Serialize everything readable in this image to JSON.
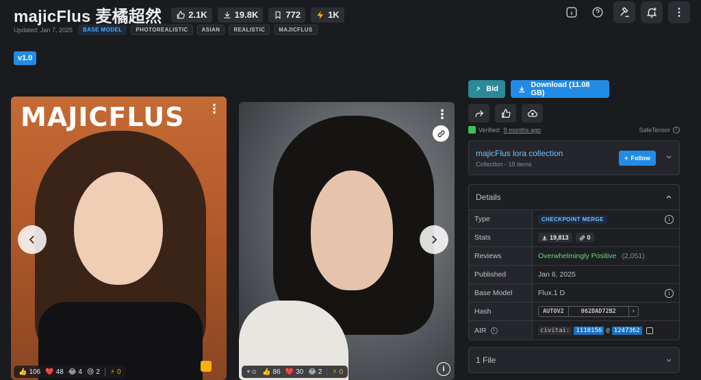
{
  "header": {
    "title": "majicFlus 麦橘超然",
    "stats": [
      {
        "icon": "thumbs-up-icon",
        "value": "2.1K"
      },
      {
        "icon": "download-icon",
        "value": "19.8K"
      },
      {
        "icon": "bookmark-icon",
        "value": "772"
      },
      {
        "icon": "lightning-icon",
        "value": "1K"
      }
    ],
    "updated": "Updated: Jan 7, 2025",
    "tags": [
      "BASE MODEL",
      "PHOTOREALISTIC",
      "ASIAN",
      "REALISTIC",
      "MAJICFLUS"
    ]
  },
  "version": "v1.0",
  "gallery": {
    "card1": {
      "overlay_title": "MAJICFLUS",
      "reactions": [
        {
          "icon": "thumbs-up-emoji",
          "glyph": "👍",
          "count": "106"
        },
        {
          "icon": "heart-emoji",
          "glyph": "❤️",
          "count": "48"
        },
        {
          "icon": "laugh-emoji",
          "glyph": "😂",
          "count": "4"
        },
        {
          "icon": "cry-emoji",
          "glyph": "😢",
          "count": "2"
        },
        {
          "icon": "lightning-emoji",
          "glyph": "⚡",
          "count": "0"
        }
      ]
    },
    "card2": {
      "reactions": [
        {
          "icon": "thumbs-up-emoji",
          "glyph": "👍",
          "count": "86"
        },
        {
          "icon": "heart-emoji",
          "glyph": "❤️",
          "count": "30"
        },
        {
          "icon": "laugh-emoji",
          "glyph": "😂",
          "count": "2"
        },
        {
          "icon": "lightning-emoji",
          "glyph": "⚡",
          "count": "0"
        }
      ]
    }
  },
  "actions": {
    "bid_label": "Bid",
    "download_label": "Download (11.08 GB)"
  },
  "verified": {
    "prefix": "Verified:",
    "when": "9 months ago",
    "format": "SafeTensor"
  },
  "collection": {
    "name": "majicFlus lora collection",
    "subtitle": "Collection - 19 items",
    "follow_label": "Follow"
  },
  "details": {
    "heading": "Details",
    "type_label": "Type",
    "type_value": "CHECKPOINT MERGE",
    "stats_label": "Stats",
    "stats_downloads": "19,813",
    "stats_links": "0",
    "reviews_label": "Reviews",
    "reviews_value": "Overwhelmingly Positive",
    "reviews_count": "(2,051)",
    "published_label": "Published",
    "published_value": "Jan 6, 2025",
    "base_model_label": "Base Model",
    "base_model_value": "Flux.1 D",
    "hash_label": "Hash",
    "hash_type": "AUTOV2",
    "hash_value": "062DAD72B2",
    "air_label": "AIR",
    "air_prefix": "civitai:",
    "air_model": "1110156",
    "air_at": "@",
    "air_version": "1247362"
  },
  "files": {
    "label": "1 File"
  },
  "colors": {
    "accent": "#228be6",
    "bid": "#2a8a97",
    "positive": "#69db7c"
  }
}
